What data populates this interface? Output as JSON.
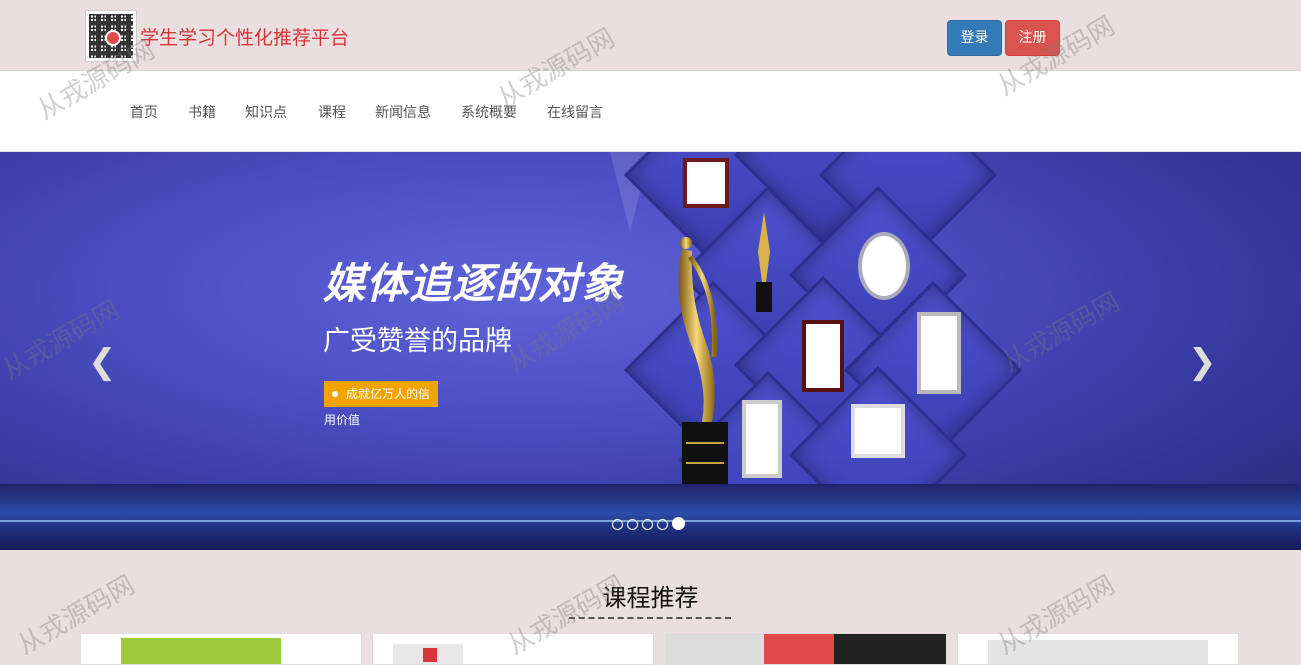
{
  "header": {
    "site_title": "学生学习个性化推荐平台",
    "login_label": "登录",
    "register_label": "注册",
    "qr_icon": "qr-code-icon"
  },
  "nav": {
    "items": [
      "首页",
      "书籍",
      "知识点",
      "课程",
      "新闻信息",
      "系统概要",
      "在线留言"
    ]
  },
  "carousel": {
    "headline": "媒体追逐的对象",
    "subheadline": "广受赞誉的品牌",
    "tagline": "成就亿万人的信用价值",
    "prev_icon": "chevron-left-icon",
    "next_icon": "chevron-right-icon",
    "active_indicator": 5,
    "indicator_count": 5
  },
  "section": {
    "title": "课程推荐"
  },
  "watermark": "从戎源码网",
  "colors": {
    "title_red": "#d9343a",
    "login_blue": "#337ab7",
    "register_red": "#d9534f",
    "header_bg": "#eadede",
    "banner_blue": "#4b4fc2",
    "tagline_orange": "#f2a300"
  }
}
